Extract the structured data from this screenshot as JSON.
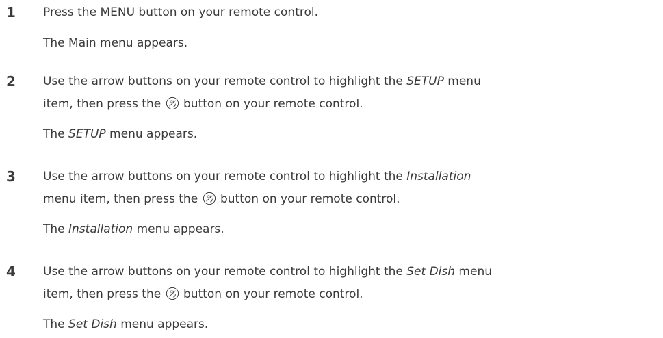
{
  "steps": [
    {
      "number": "1",
      "lines": [
        [
          "Press the MENU button on your remote control."
        ]
      ],
      "result": [
        "The Main menu appears."
      ]
    },
    {
      "number": "2",
      "lines": [
        [
          "Use the arrow buttons on your remote control to highlight the ",
          "SETUP",
          " menu"
        ],
        [
          "item, then press the ",
          "button on your remote control."
        ]
      ],
      "result": [
        "The ",
        "SETUP",
        " menu appears."
      ]
    },
    {
      "number": "3",
      "lines": [
        [
          "Use the arrow buttons on your remote control to highlight the ",
          "Installation"
        ],
        [
          "menu item, then press the ",
          "button on your remote control."
        ]
      ],
      "result": [
        "The ",
        "Installation",
        " menu appears."
      ]
    },
    {
      "number": "4",
      "lines": [
        [
          "Use the arrow buttons on your remote control to highlight the ",
          "Set Dish",
          " menu"
        ],
        [
          "item, then press the ",
          "button on your remote control."
        ]
      ],
      "result": [
        "The ",
        "Set Dish",
        " menu appears."
      ]
    }
  ],
  "ok_icon": {
    "name": "ok-button-icon",
    "label": "OK",
    "color": "#3a3a3a"
  }
}
